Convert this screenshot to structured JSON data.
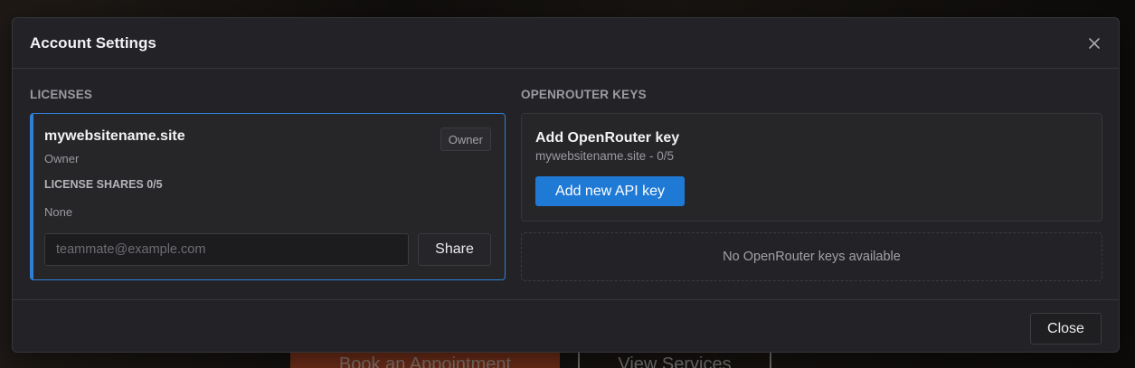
{
  "background": {
    "primary_button": "Book an Appointment",
    "secondary_button": "View Services"
  },
  "modal": {
    "title": "Account Settings",
    "close_icon": "close-icon",
    "licenses": {
      "section_title": "LICENSES",
      "card": {
        "domain": "mywebsitename.site",
        "role": "Owner",
        "badge": "Owner",
        "shares_label": "LICENSE SHARES 0/5",
        "shares_value": "None",
        "email_placeholder": "teammate@example.com",
        "share_button": "Share"
      }
    },
    "openrouter": {
      "section_title": "OPENROUTER KEYS",
      "add_card": {
        "title": "Add OpenRouter key",
        "subtitle": "mywebsitename.site - 0/5",
        "button": "Add new API key"
      },
      "empty_text": "No OpenRouter keys available"
    },
    "footer": {
      "close_button": "Close"
    }
  },
  "colors": {
    "accent": "#1f7ad6",
    "active_border": "#2f7fd6",
    "modal_bg": "#232327",
    "background_cta": "#c8532c"
  }
}
